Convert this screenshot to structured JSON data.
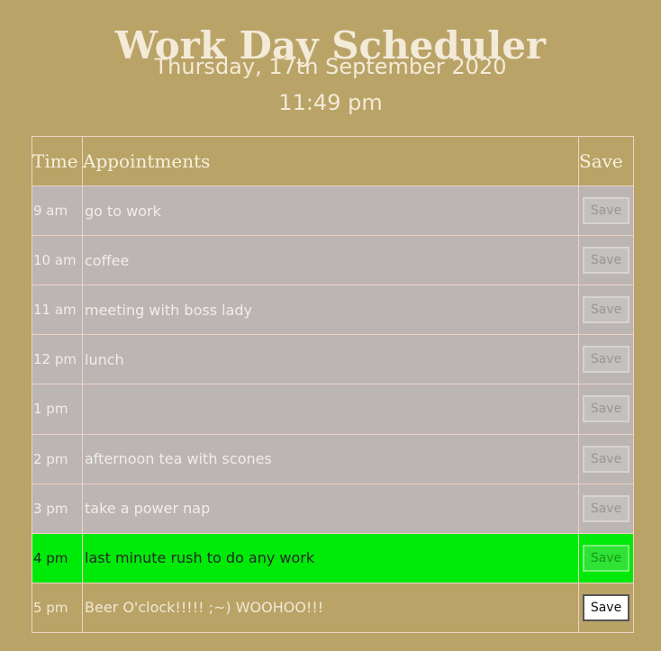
{
  "header": {
    "title": "Work Day Scheduler",
    "date": "Thursday, 17th September 2020",
    "time": "11:49 pm"
  },
  "table": {
    "columns": [
      "Time",
      "Appointments",
      "Save"
    ],
    "rows": [
      {
        "hour": "9 am",
        "appointment": "go to work",
        "status": "past",
        "save_label": "Save"
      },
      {
        "hour": "10 am",
        "appointment": "coffee",
        "status": "past",
        "save_label": "Save"
      },
      {
        "hour": "11 am",
        "appointment": "meeting with boss lady",
        "status": "past",
        "save_label": "Save"
      },
      {
        "hour": "12 pm",
        "appointment": "lunch",
        "status": "past",
        "save_label": "Save"
      },
      {
        "hour": "1 pm",
        "appointment": "",
        "status": "past",
        "save_label": "Save"
      },
      {
        "hour": "2 pm",
        "appointment": "afternoon tea with scones",
        "status": "past",
        "save_label": "Save"
      },
      {
        "hour": "3 pm",
        "appointment": "take a power nap",
        "status": "past",
        "save_label": "Save"
      },
      {
        "hour": "4 pm",
        "appointment": "last minute rush to do any work",
        "status": "present",
        "save_label": "Save"
      },
      {
        "hour": "5 pm",
        "appointment": "Beer O'clock!!!!! ;~) WOOHOO!!!",
        "status": "future",
        "save_label": "Save"
      }
    ]
  },
  "colors": {
    "background": "#b9a367",
    "past": "#bbb5b3",
    "present": "#00ea09",
    "future": "#b9a367"
  }
}
